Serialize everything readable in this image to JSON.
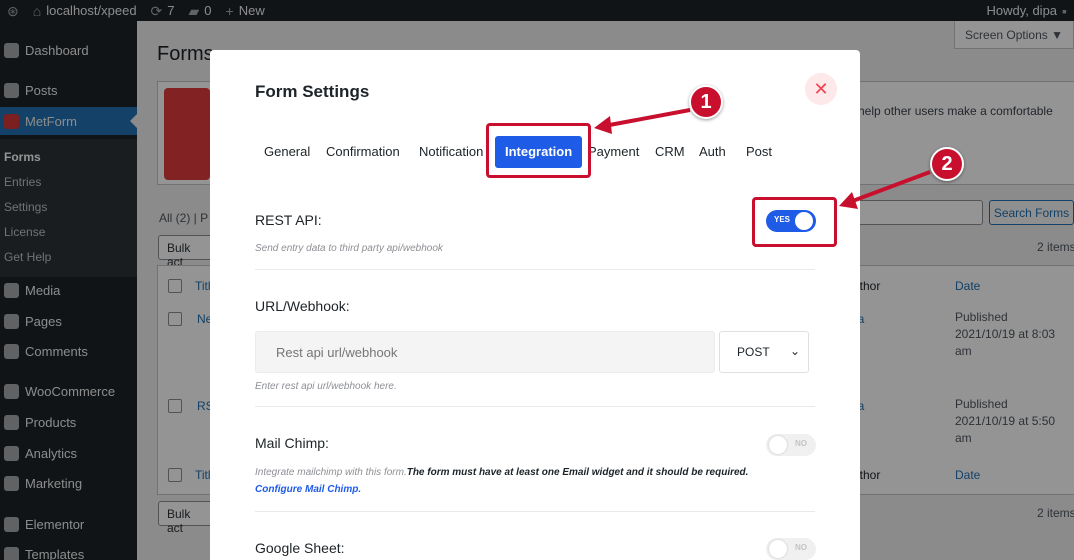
{
  "admin_bar": {
    "site": "localhost/xpeed",
    "updates_count": "7",
    "comments_count": "0",
    "new_label": "New",
    "greeting": "Howdy, dipa"
  },
  "sidebar": {
    "dashboard": "Dashboard",
    "posts": "Posts",
    "metform": "MetForm",
    "submenu": [
      "Forms",
      "Entries",
      "Settings",
      "License",
      "Get Help"
    ],
    "media": "Media",
    "pages": "Pages",
    "comments": "Comments",
    "woocommerce": "WooCommerce",
    "products": "Products",
    "analytics": "Analytics",
    "marketing": "Marketing",
    "elementor": "Elementor",
    "templates": "Templates"
  },
  "background": {
    "page_title": "Forms",
    "screen_options": "Screen Options ▼",
    "banner_text": "help other users make a comfortable",
    "search_button": "Search Forms",
    "all_filter": "All (2) | P",
    "bulk_actions": "Bulk act",
    "items_count": "2 items",
    "col_title": "Titl",
    "col_author": "uthor",
    "col_date": "Date",
    "row1": {
      "title": "Ne",
      "author": "pa",
      "status": "Published",
      "date": "2021/10/19 at 8:03",
      "ampm": "am"
    },
    "row2": {
      "title": "RS",
      "author": "pa",
      "status": "Published",
      "date": "2021/10/19 at 5:50",
      "ampm": "am"
    }
  },
  "modal": {
    "title": "Form Settings",
    "close_glyph": "✕",
    "tabs": [
      "General",
      "Confirmation",
      "Notification",
      "Integration",
      "Payment",
      "CRM",
      "Auth",
      "Post"
    ],
    "active_tab": "Integration",
    "rest_api": {
      "label": "REST API:",
      "help": "Send entry data to third party api/webhook",
      "toggle_on": true,
      "toggle_label": "YES"
    },
    "webhook": {
      "label": "URL/Webhook:",
      "placeholder": "Rest api url/webhook",
      "method": "POST",
      "help": "Enter rest api url/webhook here."
    },
    "mailchimp": {
      "label": "Mail Chimp:",
      "help_prefix": "Integrate mailchimp with this form.",
      "help_bold": "The form must have at least one Email widget and it should be required.",
      "link": "Configure Mail Chimp.",
      "toggle_on": false,
      "toggle_label": "NO"
    },
    "google_sheet": {
      "label": "Google Sheet:",
      "toggle_on": false,
      "toggle_label": "NO"
    }
  },
  "annotations": {
    "badge_1": "1",
    "badge_2": "2",
    "color": "#c8102e"
  }
}
